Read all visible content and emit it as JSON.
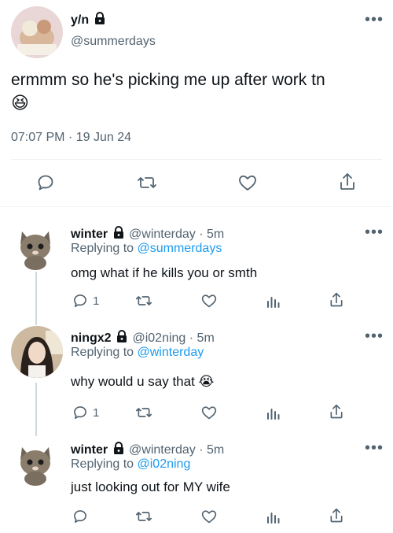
{
  "main_tweet": {
    "display_name": "y/n",
    "handle": "@summerdays",
    "text": "ermmm so he's picking me up after work tn",
    "emoji": "😆",
    "timestamp": "07:07 PM · 19 Jun 24"
  },
  "replies": [
    {
      "display_name": "winter",
      "handle": "@winterday",
      "time": "5m",
      "replying_label": "Replying to",
      "replying_to": "@summerdays",
      "text": "omg what if he kills you or smth",
      "reply_count": "1"
    },
    {
      "display_name": "ningx2",
      "handle": "@i02ning",
      "time": "5m",
      "replying_label": "Replying to",
      "replying_to": "@winterday",
      "text": "why would u say that 😭",
      "reply_count": "1"
    },
    {
      "display_name": "winter",
      "handle": "@winterday",
      "time": "5m",
      "replying_label": "Replying to",
      "replying_to": "@i02ning",
      "text": "just looking out for MY wife",
      "reply_count": ""
    }
  ],
  "separator": "·",
  "colors": {
    "link": "#1d9bf0",
    "muted": "#536471",
    "divider": "#eff3f4"
  }
}
